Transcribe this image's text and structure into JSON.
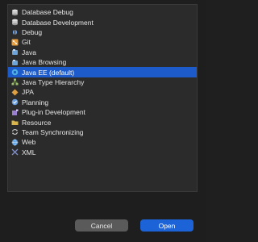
{
  "perspectives": [
    {
      "label": "Database Debug",
      "icon": "database-debug-icon",
      "color": "#c8c8c8",
      "selected": false
    },
    {
      "label": "Database Development",
      "icon": "database-development-icon",
      "color": "#c8c8c8",
      "selected": false
    },
    {
      "label": "Debug",
      "icon": "debug-bug-icon",
      "color": "#6ca0e8",
      "selected": false
    },
    {
      "label": "Git",
      "icon": "git-icon",
      "color": "#e89d3c",
      "selected": false
    },
    {
      "label": "Java",
      "icon": "java-icon",
      "color": "#6fa4d8",
      "selected": false
    },
    {
      "label": "Java Browsing",
      "icon": "java-browsing-icon",
      "color": "#6fa4d8",
      "selected": false
    },
    {
      "label": "Java EE (default)",
      "icon": "java-ee-icon",
      "color": "#4fb0e0",
      "selected": true
    },
    {
      "label": "Java Type Hierarchy",
      "icon": "java-type-hierarchy-icon",
      "color": "#9bc06a",
      "selected": false
    },
    {
      "label": "JPA",
      "icon": "jpa-icon",
      "color": "#e0a040",
      "selected": false
    },
    {
      "label": "Planning",
      "icon": "planning-icon",
      "color": "#6aa0e0",
      "selected": false
    },
    {
      "label": "Plug-in Development",
      "icon": "plugin-development-icon",
      "color": "#9a7fd0",
      "selected": false
    },
    {
      "label": "Resource",
      "icon": "resource-folder-icon",
      "color": "#d9b44a",
      "selected": false
    },
    {
      "label": "Team Synchronizing",
      "icon": "team-synchronizing-icon",
      "color": "#c8c8c8",
      "selected": false
    },
    {
      "label": "Web",
      "icon": "web-globe-icon",
      "color": "#5a9ad8",
      "selected": false
    },
    {
      "label": "XML",
      "icon": "xml-icon",
      "color": "#7f8fcf",
      "selected": false
    }
  ],
  "buttons": {
    "cancel_label": "Cancel",
    "open_label": "Open"
  }
}
